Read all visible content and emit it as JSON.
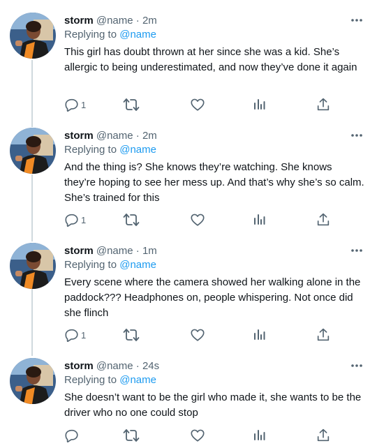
{
  "colors": {
    "accent": "#1d9bf0",
    "text": "#0f1419",
    "secondary": "#536471",
    "thread_line": "#cfd9de"
  },
  "tweets": [
    {
      "name": "storm",
      "handle": "@name",
      "separator": "·",
      "time": "2m",
      "replying_prefix": "Replying to",
      "replying_to": "@name",
      "text": "This girl has doubt thrown at her since she was a kid. She’s allergic to being underestimated, and now they’ve done it again",
      "reply_count": "1"
    },
    {
      "name": "storm",
      "handle": "@name",
      "separator": "·",
      "time": "2m",
      "replying_prefix": "Replying to",
      "replying_to": "@name",
      "text": "And the thing is? She knows they’re watching. She knows they’re hoping to see her mess up. And that’s why she’s so calm. She’s trained for this",
      "reply_count": "1"
    },
    {
      "name": "storm",
      "handle": "@name",
      "separator": "·",
      "time": "1m",
      "replying_prefix": "Replying to",
      "replying_to": "@name",
      "text": "Every scene where the camera showed her walking alone in the paddock??? Headphones on, people whispering. Not once did she flinch",
      "reply_count": "1"
    },
    {
      "name": "storm",
      "handle": "@name",
      "separator": "·",
      "time": "24s",
      "replying_prefix": "Replying to",
      "replying_to": "@name",
      "text": "She doesn’t want to be the girl who made it, she wants to be the driver who no one could stop",
      "reply_count": ""
    }
  ],
  "icons": {
    "reply": "reply-icon",
    "retweet": "retweet-icon",
    "like": "heart-icon",
    "views": "views-icon",
    "share": "share-icon",
    "more": "more-icon"
  }
}
